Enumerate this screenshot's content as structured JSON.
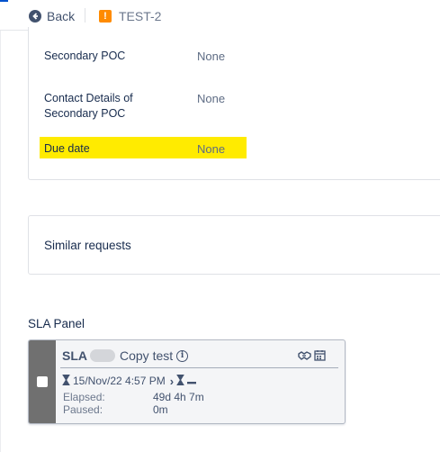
{
  "header": {
    "back_label": "Back",
    "issue_key": "TEST-2",
    "issue_icon_name": "exclamation-icon",
    "issue_icon_color": "#ff8b00"
  },
  "details": {
    "fields": [
      {
        "label": "Secondary POC",
        "value": "None"
      },
      {
        "label": "Contact Details of Secondary POC",
        "value": "None"
      },
      {
        "label": "Due date",
        "value": "None",
        "highlight_color": "#ffeb00"
      }
    ]
  },
  "similar": {
    "title": "Similar requests"
  },
  "sla_panel": {
    "heading": "SLA Panel",
    "item": {
      "name": "SLA",
      "goal": "Copy test",
      "due": "15/Nov/22 4:57 PM",
      "elapsed_label": "Elapsed:",
      "elapsed_value": "49d 4h 7m",
      "paused_label": "Paused:",
      "paused_value": "0m",
      "stripe_color": "#707070",
      "icons": [
        "info-icon",
        "handshake-icon",
        "calendar-icon",
        "hourglass-icon",
        "chevron-right-icon",
        "hourglass-icon",
        "dash-icon"
      ]
    }
  }
}
